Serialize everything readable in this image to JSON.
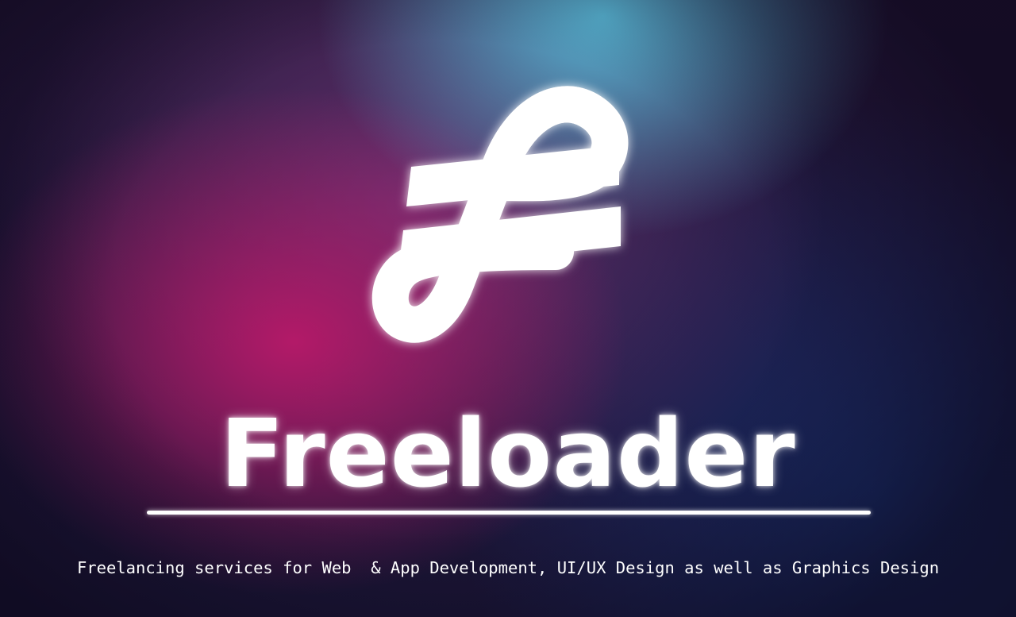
{
  "brand": {
    "name": "Freeloader",
    "tagline": "Freelancing services for Web  & App Development, UI/UX Design as well as Graphics Design",
    "logo_icon": "freeloader-f-loop-logo"
  },
  "colors": {
    "text": "#ffffff",
    "glow_cyan": "#5abedc",
    "glow_magenta": "#b91969",
    "background_dark": "#1a1535"
  }
}
